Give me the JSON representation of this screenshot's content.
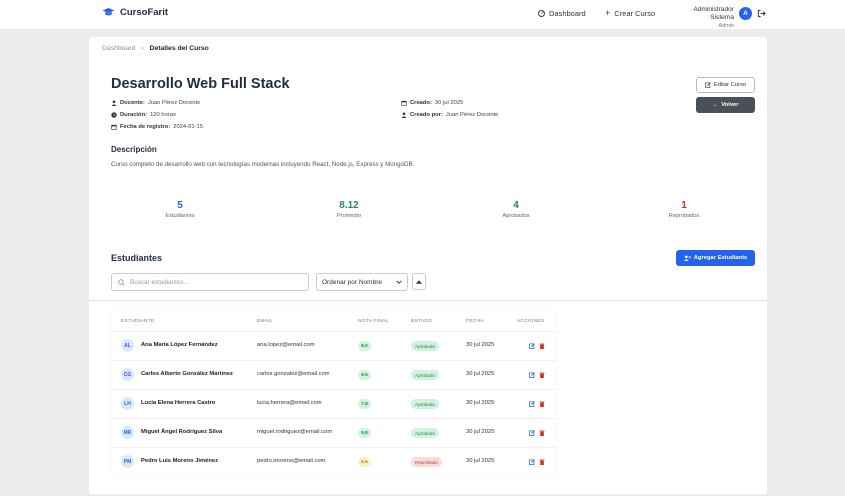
{
  "brand": {
    "name": "CursoFarit"
  },
  "nav": {
    "dashboard": "Dashboard",
    "create": "Crear Curso"
  },
  "user": {
    "name": "Administrador Sistema",
    "role": "Admin",
    "initial": "A"
  },
  "breadcrumb": {
    "home": "Dashboard",
    "current": "Detalles del Curso"
  },
  "course": {
    "title": "Desarrollo Web Full Stack",
    "teacher_label": "Docente:",
    "teacher": "Juan Pérez Docente",
    "duration_label": "Duración:",
    "duration": "120 horas",
    "registered_label": "Fecha de registro:",
    "registered": "2024-01-15",
    "created_label": "Creado:",
    "created": "30 jul 2025",
    "created_by_label": "Creado por:",
    "created_by": "Juan Pérez Docente",
    "description_title": "Descripción",
    "description": "Curso completo de desarrollo web con tecnologías modernas incluyendo React, Node.js, Express y MongoDB."
  },
  "actions": {
    "edit": "Editar Curso",
    "back": "Volver",
    "add_student": "Agregar Estudiante"
  },
  "stats": [
    {
      "value": "5",
      "label": "Estudiantes",
      "color": "#2563eb"
    },
    {
      "value": "8.12",
      "label": "Promedio",
      "color": "#1e8a6e"
    },
    {
      "value": "4",
      "label": "Aprobados",
      "color": "#1e8a4c"
    },
    {
      "value": "1",
      "label": "Reprobados",
      "color": "#dc2626"
    }
  ],
  "students_section": {
    "title": "Estudiantes",
    "search_placeholder": "Buscar estudiantes...",
    "sort_selected": "Ordenar por Nombre"
  },
  "table": {
    "headers": [
      "ESTUDIANTE",
      "EMAIL",
      "NOTA FINAL",
      "ESTADO",
      "FECHA",
      "ACCIONES"
    ],
    "rows": [
      {
        "initials": "AL",
        "name": "Ana María López Fernández",
        "email": "ana.lopez@email.com",
        "grade": "8.0",
        "status": "Aprobado",
        "date": "30 jul 2025"
      },
      {
        "initials": "CG",
        "name": "Carlos Alberto González Martínez",
        "email": "carlos.gonzalez@email.com",
        "grade": "9.5",
        "status": "Aprobado",
        "date": "30 jul 2025"
      },
      {
        "initials": "LH",
        "name": "Lucía Elena Herrera Castro",
        "email": "lucia.herrera@email.com",
        "grade": "7.8",
        "status": "Aprobado",
        "date": "30 jul 2025"
      },
      {
        "initials": "MR",
        "name": "Miguel Ángel Rodríguez Silva",
        "email": "miguel.rodriguez@email.com",
        "grade": "9.8",
        "status": "Aprobado",
        "date": "30 jul 2025"
      },
      {
        "initials": "PM",
        "name": "Pedro Luis Moreno Jiménez",
        "email": "pedro.moreno@email.com",
        "grade": "5.5",
        "status": "Reprobado",
        "date": "30 jul 2025"
      }
    ]
  }
}
